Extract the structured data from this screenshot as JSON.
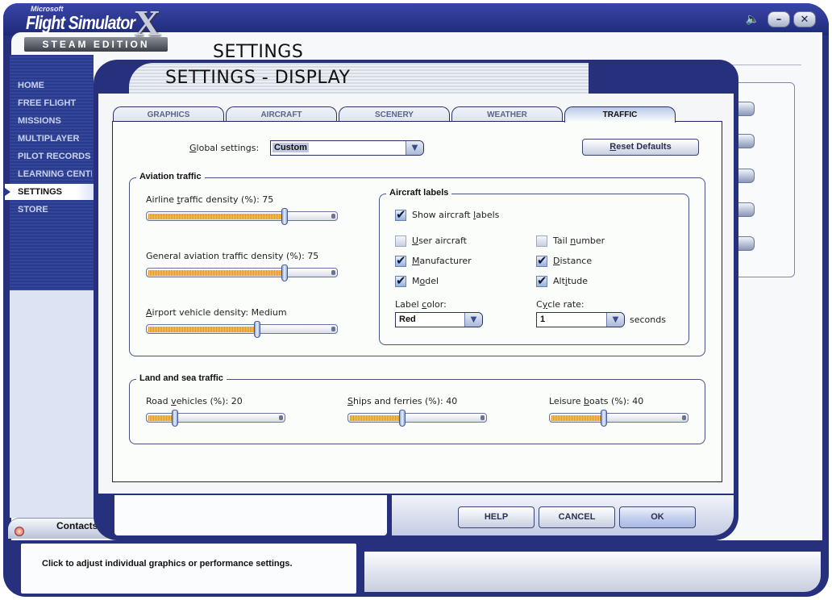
{
  "app": {
    "logo_microsoft": "Microsoft",
    "logo_title": "Flight Simulator",
    "logo_x": "X",
    "logo_edition": "STEAM EDITION",
    "speaker_icon": "speaker-icon",
    "minimize_label": "–",
    "close_label": "✕"
  },
  "page": {
    "title": "SETTINGS"
  },
  "nav": {
    "items": [
      {
        "label": "HOME"
      },
      {
        "label": "FREE FLIGHT"
      },
      {
        "label": "MISSIONS"
      },
      {
        "label": "MULTIPLAYER"
      },
      {
        "label": "PILOT RECORDS"
      },
      {
        "label": "LEARNING CENTER"
      },
      {
        "label": "SETTINGS",
        "active": true
      },
      {
        "label": "STORE"
      }
    ]
  },
  "contacts": {
    "label": "Contacts"
  },
  "status": {
    "text": "Click to adjust individual graphics or performance settings."
  },
  "dialog": {
    "title": "SETTINGS - DISPLAY",
    "tabs": [
      {
        "label": "GRAPHICS"
      },
      {
        "label": "AIRCRAFT"
      },
      {
        "label": "SCENERY"
      },
      {
        "label": "WEATHER"
      },
      {
        "label": "TRAFFIC",
        "active": true
      }
    ],
    "global_settings": {
      "label_prefix": "G",
      "label_rest": "lobal settings:",
      "value": "Custom"
    },
    "reset_defaults": {
      "label_prefix": "R",
      "label_rest": "eset Defaults"
    },
    "aviation_traffic": {
      "legend": "Aviation traffic",
      "airline": {
        "label_a": "Airline ",
        "label_u": "t",
        "label_b": "raffic density (%): ",
        "value": "75",
        "fraction": 0.75
      },
      "general": {
        "label_a": "General aviation traf",
        "label_u": "f",
        "label_b": "ic density (%): ",
        "value": "75",
        "fraction": 0.75
      },
      "airport": {
        "label_u": "A",
        "label_b": "irport vehicle density: ",
        "value": "Medium",
        "fraction": 0.6
      }
    },
    "aircraft_labels": {
      "legend": "Aircraft labels",
      "show": {
        "label_a": "Show aircraft ",
        "label_u": "l",
        "label_b": "abels",
        "checked": true
      },
      "user_aircraft": {
        "label_u": "U",
        "label_b": "ser aircraft",
        "checked": false
      },
      "tail_number": {
        "label_a": "Tail ",
        "label_u": "n",
        "label_b": "umber",
        "checked": false
      },
      "manufacturer": {
        "label_u": "M",
        "label_b": "anufacturer",
        "checked": true
      },
      "distance": {
        "label_u": "D",
        "label_b": "istance",
        "checked": true
      },
      "model": {
        "label_a": "M",
        "label_u": "o",
        "label_b": "del",
        "checked": true
      },
      "altitude": {
        "label_a": "Alt",
        "label_u": "i",
        "label_b": "tude",
        "checked": true
      },
      "label_color": {
        "label_a": "Label ",
        "label_u": "c",
        "label_b": "olor:",
        "value": "Red"
      },
      "cycle_rate": {
        "label_a": "C",
        "label_u": "y",
        "label_b": "cle rate:",
        "value": "1",
        "unit": "seconds"
      }
    },
    "land_sea": {
      "legend": "Land and sea traffic",
      "road": {
        "label_a": "Road ",
        "label_u": "v",
        "label_b": "ehicles (%): ",
        "value": "20",
        "fraction": 0.2
      },
      "ships": {
        "label_u": "S",
        "label_b": "hips and ferries (%): ",
        "value": "40",
        "fraction": 0.4
      },
      "leisure": {
        "label_a": "Leisure ",
        "label_u": "b",
        "label_b": "oats (%): ",
        "value": "40",
        "fraction": 0.4
      }
    },
    "buttons": {
      "help": "HELP",
      "cancel": "CANCEL",
      "ok": "OK"
    }
  }
}
